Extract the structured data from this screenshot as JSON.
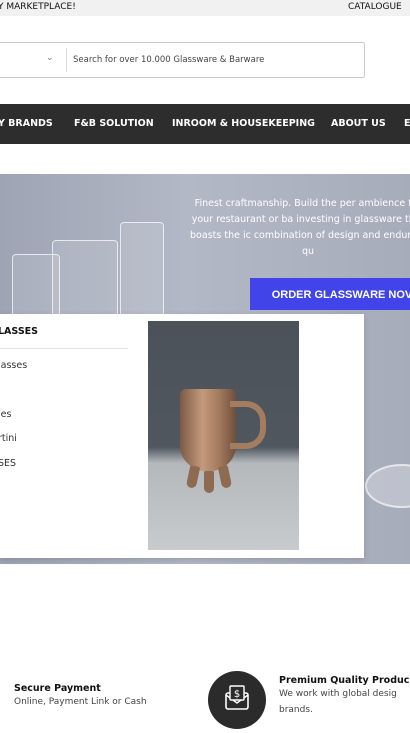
{
  "topbar": {
    "left_text": "Y MARKETPLACE!",
    "right_text": "CATALOGUE"
  },
  "search": {
    "placeholder": "Search for over 10.000 Glassware & Barware",
    "category_chevron": "chevron-down-icon"
  },
  "nav": {
    "items": [
      "Y BRANDS",
      "F&B SOLUTION",
      "INROOM & HOUSEKEEPING",
      "ABOUT US",
      "E"
    ]
  },
  "hero": {
    "text": "Finest craftmanship. Build the per ambience for your restaurant or ba investing in glassware that boasts the ic combination of design and enduring qu",
    "cta_label": "ORDER GLASSWARE NOV",
    "cta_color": "#4144e8"
  },
  "dropdown": {
    "heading": "LASSES",
    "items": [
      "lasses",
      "les",
      "rtini",
      "SES"
    ]
  },
  "features": {
    "secure_payment": {
      "title": "Secure Payment",
      "subtitle": "Online, Payment Link or Cash"
    },
    "premium_quality": {
      "title": "Premium Quality Produc",
      "subtitle_line1": "We work with global desig",
      "subtitle_line2": "brands.",
      "icon": "money-envelope-icon"
    }
  }
}
